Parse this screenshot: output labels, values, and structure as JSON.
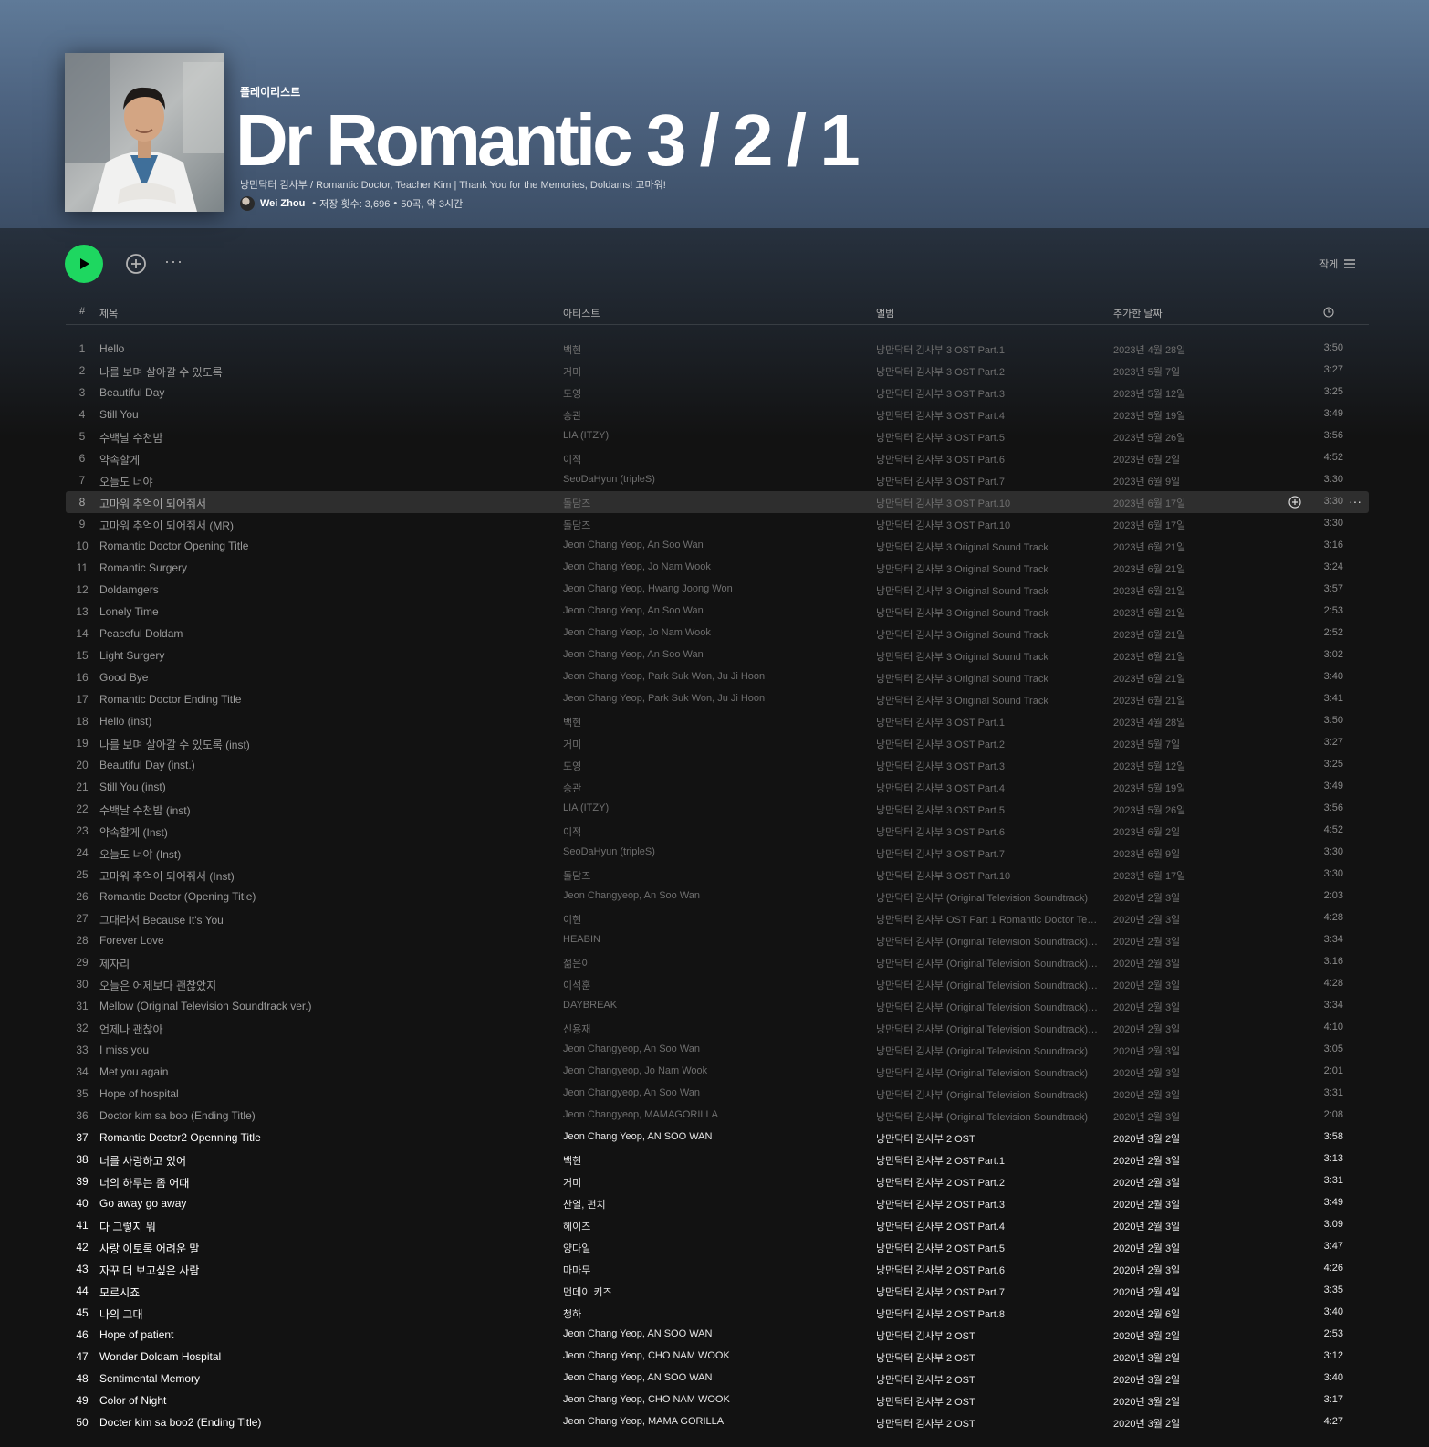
{
  "header": {
    "type_label": "플레이리스트",
    "title": "Dr Romantic 3 / 2 / 1",
    "description": "낭만닥터 김사부 / Romantic Doctor, Teacher Kim | Thank You for the Memories, Doldams! 고마워!",
    "owner": "Wei Zhou",
    "saves": "저장 횟수: 3,696",
    "stats": "50곡, 약 3시간",
    "separator": "•"
  },
  "actions": {
    "play_icon": "play-icon",
    "add_icon": "add-circle-icon",
    "more_label": "···",
    "view_label": "작게",
    "view_icon": "list-icon"
  },
  "columns": {
    "num": "#",
    "title": "제목",
    "artist": "아티스트",
    "album": "앨범",
    "date_added": "추가한 날짜",
    "duration_icon": "clock-icon"
  },
  "selected_row": 8,
  "selected_row_more": "···",
  "colors": {
    "accent_green": "#1ed760",
    "hero_top": "#5f7a98",
    "background": "#121212"
  },
  "tracks": [
    {
      "n": "1",
      "title": "Hello",
      "artist": "백현",
      "album": "낭만닥터 김사부 3 OST Part.1",
      "date": "2023년 4월 28일",
      "duration": "3:50"
    },
    {
      "n": "2",
      "title": "나를 보며 살아갈 수 있도록",
      "artist": "거미",
      "album": "낭만닥터 김사부 3 OST Part.2",
      "date": "2023년 5월 7일",
      "duration": "3:27"
    },
    {
      "n": "3",
      "title": "Beautiful Day",
      "artist": "도영",
      "album": "낭만닥터 김사부 3 OST Part.3",
      "date": "2023년 5월 12일",
      "duration": "3:25"
    },
    {
      "n": "4",
      "title": "Still You",
      "artist": "승관",
      "album": "낭만닥터 김사부 3 OST Part.4",
      "date": "2023년 5월 19일",
      "duration": "3:49"
    },
    {
      "n": "5",
      "title": "수백날 수천밤",
      "artist": "LIA (ITZY)",
      "album": "낭만닥터 김사부 3 OST Part.5",
      "date": "2023년 5월 26일",
      "duration": "3:56"
    },
    {
      "n": "6",
      "title": "약속할게",
      "artist": "이적",
      "album": "낭만닥터 김사부 3 OST Part.6",
      "date": "2023년 6월 2일",
      "duration": "4:52"
    },
    {
      "n": "7",
      "title": "오늘도 너야",
      "artist": "SeoDaHyun (tripleS)",
      "album": "낭만닥터 김사부 3 OST Part.7",
      "date": "2023년 6월 9일",
      "duration": "3:30"
    },
    {
      "n": "8",
      "title": "고마워 추억이 되어줘서",
      "artist": "돌담즈",
      "album": "낭만닥터 김사부 3 OST Part.10",
      "date": "2023년 6월 17일",
      "duration": "3:30"
    },
    {
      "n": "9",
      "title": "고마워 추억이 되어줘서 (MR)",
      "artist": "돌담즈",
      "album": "낭만닥터 김사부 3 OST Part.10",
      "date": "2023년 6월 17일",
      "duration": "3:30"
    },
    {
      "n": "10",
      "title": "Romantic Doctor Opening Title",
      "artist": "Jeon Chang Yeop, An Soo Wan",
      "album": "낭만닥터 김사부 3 Original Sound Track",
      "date": "2023년 6월 21일",
      "duration": "3:16"
    },
    {
      "n": "11",
      "title": "Romantic Surgery",
      "artist": "Jeon Chang Yeop, Jo Nam Wook",
      "album": "낭만닥터 김사부 3 Original Sound Track",
      "date": "2023년 6월 21일",
      "duration": "3:24"
    },
    {
      "n": "12",
      "title": "Doldamgers",
      "artist": "Jeon Chang Yeop, Hwang Joong Won",
      "album": "낭만닥터 김사부 3 Original Sound Track",
      "date": "2023년 6월 21일",
      "duration": "3:57"
    },
    {
      "n": "13",
      "title": "Lonely Time",
      "artist": "Jeon Chang Yeop, An Soo Wan",
      "album": "낭만닥터 김사부 3 Original Sound Track",
      "date": "2023년 6월 21일",
      "duration": "2:53"
    },
    {
      "n": "14",
      "title": "Peaceful Doldam",
      "artist": "Jeon Chang Yeop, Jo Nam Wook",
      "album": "낭만닥터 김사부 3 Original Sound Track",
      "date": "2023년 6월 21일",
      "duration": "2:52"
    },
    {
      "n": "15",
      "title": "Light Surgery",
      "artist": "Jeon Chang Yeop, An Soo Wan",
      "album": "낭만닥터 김사부 3 Original Sound Track",
      "date": "2023년 6월 21일",
      "duration": "3:02"
    },
    {
      "n": "16",
      "title": "Good Bye",
      "artist": "Jeon Chang Yeop, Park Suk Won, Ju Ji Hoon",
      "album": "낭만닥터 김사부 3 Original Sound Track",
      "date": "2023년 6월 21일",
      "duration": "3:40"
    },
    {
      "n": "17",
      "title": "Romantic Doctor Ending Title",
      "artist": "Jeon Chang Yeop, Park Suk Won, Ju Ji Hoon",
      "album": "낭만닥터 김사부 3 Original Sound Track",
      "date": "2023년 6월 21일",
      "duration": "3:41"
    },
    {
      "n": "18",
      "title": "Hello (inst)",
      "artist": "백현",
      "album": "낭만닥터 김사부 3 OST Part.1",
      "date": "2023년 4월 28일",
      "duration": "3:50"
    },
    {
      "n": "19",
      "title": "나를 보며 살아갈 수 있도록 (inst)",
      "artist": "거미",
      "album": "낭만닥터 김사부 3 OST Part.2",
      "date": "2023년 5월 7일",
      "duration": "3:27"
    },
    {
      "n": "20",
      "title": "Beautiful Day (inst.)",
      "artist": "도영",
      "album": "낭만닥터 김사부 3 OST Part.3",
      "date": "2023년 5월 12일",
      "duration": "3:25"
    },
    {
      "n": "21",
      "title": "Still You (inst)",
      "artist": "승관",
      "album": "낭만닥터 김사부 3 OST Part.4",
      "date": "2023년 5월 19일",
      "duration": "3:49"
    },
    {
      "n": "22",
      "title": "수백날 수천밤 (inst)",
      "artist": "LIA (ITZY)",
      "album": "낭만닥터 김사부 3 OST Part.5",
      "date": "2023년 5월 26일",
      "duration": "3:56"
    },
    {
      "n": "23",
      "title": "약속할게 (Inst)",
      "artist": "이적",
      "album": "낭만닥터 김사부 3 OST Part.6",
      "date": "2023년 6월 2일",
      "duration": "4:52"
    },
    {
      "n": "24",
      "title": "오늘도 너야 (Inst)",
      "artist": "SeoDaHyun (tripleS)",
      "album": "낭만닥터 김사부 3 OST Part.7",
      "date": "2023년 6월 9일",
      "duration": "3:30"
    },
    {
      "n": "25",
      "title": "고마워 추억이 되어줘서 (Inst)",
      "artist": "돌담즈",
      "album": "낭만닥터 김사부 3 OST Part.10",
      "date": "2023년 6월 17일",
      "duration": "3:30"
    },
    {
      "n": "26",
      "title": "Romantic Doctor (Opening Title)",
      "artist": "Jeon Changyeop, An Soo Wan",
      "album": "낭만닥터 김사부 (Original Television Soundtrack)",
      "date": "2020년 2월 3일",
      "duration": "2:03"
    },
    {
      "n": "27",
      "title": "그대라서 Because It's You",
      "artist": "이현",
      "album": "낭만닥터 김사부 OST Part 1 Romantic Doctor Teach...",
      "date": "2020년 2월 3일",
      "duration": "4:28"
    },
    {
      "n": "28",
      "title": "Forever Love",
      "artist": "HEABIN",
      "album": "낭만닥터 김사부 (Original Television Soundtrack) P...",
      "date": "2020년 2월 3일",
      "duration": "3:34"
    },
    {
      "n": "29",
      "title": "제자리",
      "artist": "젊은이",
      "album": "낭만닥터 김사부 (Original Television Soundtrack) P...",
      "date": "2020년 2월 3일",
      "duration": "3:16"
    },
    {
      "n": "30",
      "title": "오늘은 어제보다 괜찮았지",
      "artist": "이석훈",
      "album": "낭만닥터 김사부 (Original Television Soundtrack) P...",
      "date": "2020년 2월 3일",
      "duration": "4:28"
    },
    {
      "n": "31",
      "title": "Mellow (Original Television Soundtrack ver.)",
      "artist": "DAYBREAK",
      "album": "낭만닥터 김사부 (Original Television Soundtrack) P...",
      "date": "2020년 2월 3일",
      "duration": "3:34"
    },
    {
      "n": "32",
      "title": "언제나 괜찮아",
      "artist": "신용재",
      "album": "낭만닥터 김사부 (Original Television Soundtrack) P...",
      "date": "2020년 2월 3일",
      "duration": "4:10"
    },
    {
      "n": "33",
      "title": "I miss you",
      "artist": "Jeon Changyeop, An Soo Wan",
      "album": "낭만닥터 김사부 (Original Television Soundtrack)",
      "date": "2020년 2월 3일",
      "duration": "3:05"
    },
    {
      "n": "34",
      "title": "Met you again",
      "artist": "Jeon Changyeop, Jo Nam Wook",
      "album": "낭만닥터 김사부 (Original Television Soundtrack)",
      "date": "2020년 2월 3일",
      "duration": "2:01"
    },
    {
      "n": "35",
      "title": "Hope of hospital",
      "artist": "Jeon Changyeop, An Soo Wan",
      "album": "낭만닥터 김사부 (Original Television Soundtrack)",
      "date": "2020년 2월 3일",
      "duration": "3:31"
    },
    {
      "n": "36",
      "title": "Doctor kim sa boo (Ending Title)",
      "artist": "Jeon Changyeop, MAMAGORILLA",
      "album": "낭만닥터 김사부 (Original Television Soundtrack)",
      "date": "2020년 2월 3일",
      "duration": "2:08"
    },
    {
      "n": "37",
      "title": "Romantic Doctor2 Openning Title",
      "artist": "Jeon Chang Yeop, AN SOO WAN",
      "album": "낭만닥터 김사부 2 OST",
      "date": "2020년 3월 2일",
      "duration": "3:58"
    },
    {
      "n": "38",
      "title": "너를 사랑하고 있어",
      "artist": "백현",
      "album": "낭만닥터 김사부 2 OST Part.1",
      "date": "2020년 2월 3일",
      "duration": "3:13"
    },
    {
      "n": "39",
      "title": "너의 하루는 좀 어때",
      "artist": "거미",
      "album": "낭만닥터 김사부 2 OST Part.2",
      "date": "2020년 2월 3일",
      "duration": "3:31"
    },
    {
      "n": "40",
      "title": "Go away go away",
      "artist": "찬열, 펀치",
      "album": "낭만닥터 김사부 2 OST Part.3",
      "date": "2020년 2월 3일",
      "duration": "3:49"
    },
    {
      "n": "41",
      "title": "다 그렇지 뭐",
      "artist": "헤이즈",
      "album": "낭만닥터 김사부 2 OST Part.4",
      "date": "2020년 2월 3일",
      "duration": "3:09"
    },
    {
      "n": "42",
      "title": "사랑 이토록 어려운 말",
      "artist": "양다일",
      "album": "낭만닥터 김사부 2 OST Part.5",
      "date": "2020년 2월 3일",
      "duration": "3:47"
    },
    {
      "n": "43",
      "title": "자꾸 더 보고싶은 사람",
      "artist": "마마무",
      "album": "낭만닥터 김사부 2 OST Part.6",
      "date": "2020년 2월 3일",
      "duration": "4:26"
    },
    {
      "n": "44",
      "title": "모르시죠",
      "artist": "먼데이 키즈",
      "album": "낭만닥터 김사부 2 OST Part.7",
      "date": "2020년 2월 4일",
      "duration": "3:35"
    },
    {
      "n": "45",
      "title": "나의 그대",
      "artist": "청하",
      "album": "낭만닥터 김사부 2 OST Part.8",
      "date": "2020년 2월 6일",
      "duration": "3:40"
    },
    {
      "n": "46",
      "title": "Hope of patient",
      "artist": "Jeon Chang Yeop, AN SOO WAN",
      "album": "낭만닥터 김사부 2 OST",
      "date": "2020년 3월 2일",
      "duration": "2:53"
    },
    {
      "n": "47",
      "title": "Wonder Doldam Hospital",
      "artist": "Jeon Chang Yeop, CHO NAM WOOK",
      "album": "낭만닥터 김사부 2 OST",
      "date": "2020년 3월 2일",
      "duration": "3:12"
    },
    {
      "n": "48",
      "title": "Sentimental Memory",
      "artist": "Jeon Chang Yeop, AN SOO WAN",
      "album": "낭만닥터 김사부 2 OST",
      "date": "2020년 3월 2일",
      "duration": "3:40"
    },
    {
      "n": "49",
      "title": "Color of Night",
      "artist": "Jeon Chang Yeop, CHO NAM WOOK",
      "album": "낭만닥터 김사부 2 OST",
      "date": "2020년 3월 2일",
      "duration": "3:17"
    },
    {
      "n": "50",
      "title": "Docter kim sa boo2 (Ending Title)",
      "artist": "Jeon Chang Yeop, MAMA GORILLA",
      "album": "낭만닥터 김사부 2 OST",
      "date": "2020년 3월 2일",
      "duration": "4:27"
    }
  ]
}
